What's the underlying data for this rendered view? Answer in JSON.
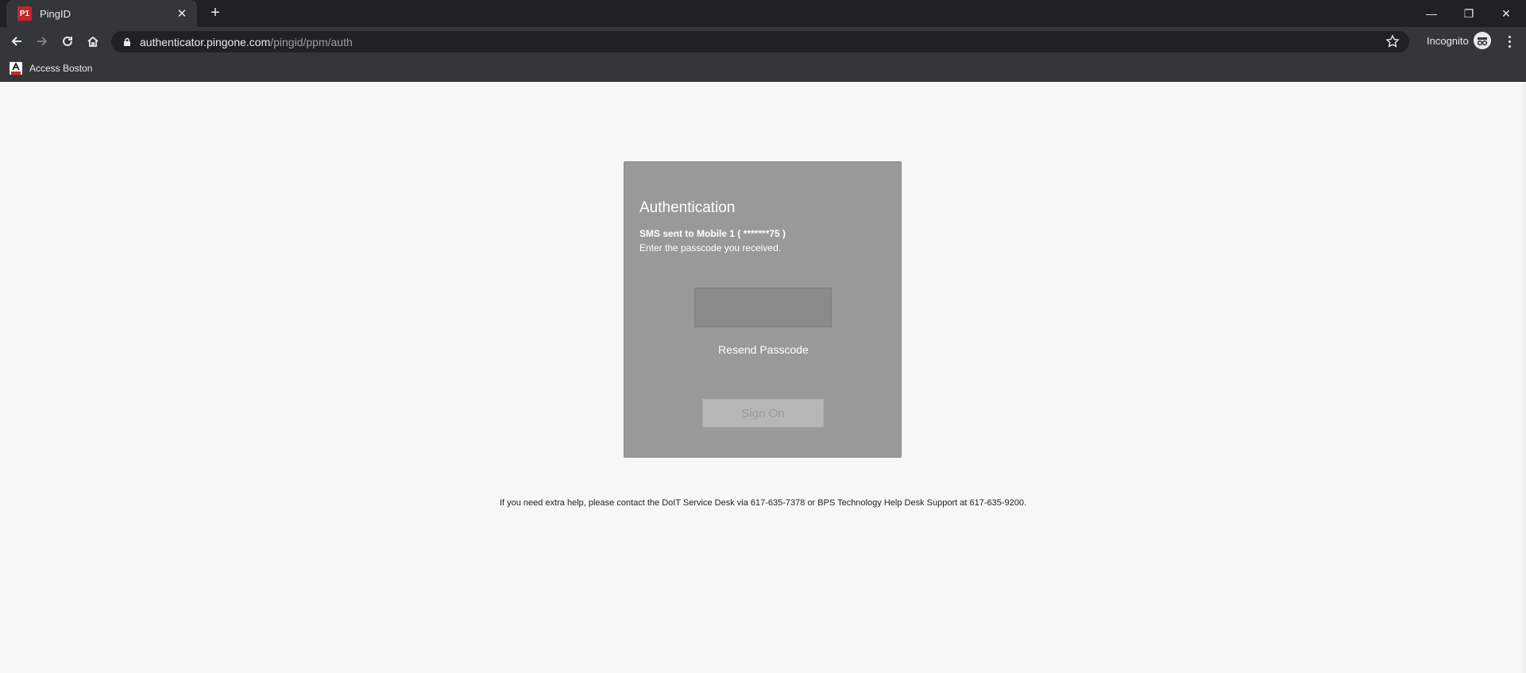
{
  "browser": {
    "tab": {
      "title": "PingID",
      "favicon_text": "P1",
      "close_label": "✕"
    },
    "new_tab_label": "+",
    "window_controls": {
      "minimize": "—",
      "restore": "❐",
      "close": "✕"
    },
    "url": {
      "host": "authenticator.pingone.com",
      "path": "/pingid/ppm/auth"
    },
    "incognito_label": "Incognito",
    "bookmarks": [
      {
        "label": "Access Boston"
      }
    ]
  },
  "auth": {
    "title": "Authentication",
    "sms_status": "SMS sent to Mobile 1 ( *******75 )",
    "instruction": "Enter the passcode you received.",
    "passcode_value": "",
    "resend_label": "Resend Passcode",
    "signon_label": "Sign On"
  },
  "footer": {
    "help_text": "If you need extra help, please contact the DoIT Service Desk via 617-635-7378 or BPS Technology Help Desk Support at 617-635-9200."
  },
  "colors": {
    "chrome_dark": "#202124",
    "chrome_toolbar": "#35363a",
    "card_bg": "#999999",
    "page_bg": "#f7f7f7",
    "favicon_red": "#c4262e"
  }
}
